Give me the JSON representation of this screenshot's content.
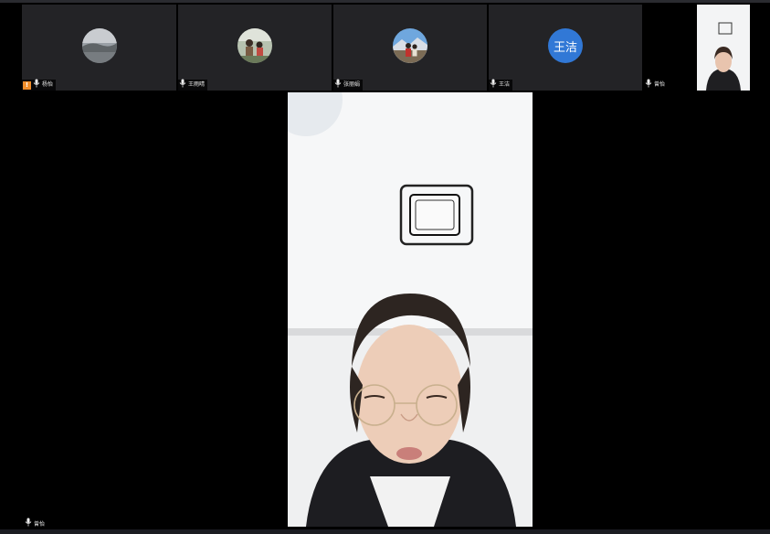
{
  "participants": [
    {
      "name": "杨怡",
      "avatar_type": "photo",
      "avatar_desc_icon": "landscape-avatar-icon",
      "warning": true
    },
    {
      "name": "王雨晴",
      "avatar_type": "photo",
      "avatar_desc_icon": "family-photo-avatar-icon"
    },
    {
      "name": "张丽娟",
      "avatar_type": "photo",
      "avatar_desc_icon": "travel-photo-avatar-icon"
    },
    {
      "name": "王洁",
      "avatar_type": "initial",
      "initial": "王洁",
      "avatar_color": "#3178d6"
    },
    {
      "name": "曾怡",
      "avatar_type": "video"
    }
  ],
  "active_speaker": {
    "name": "曾怡"
  },
  "icons": {
    "mic": "microphone-icon",
    "warning": "warning-icon"
  }
}
